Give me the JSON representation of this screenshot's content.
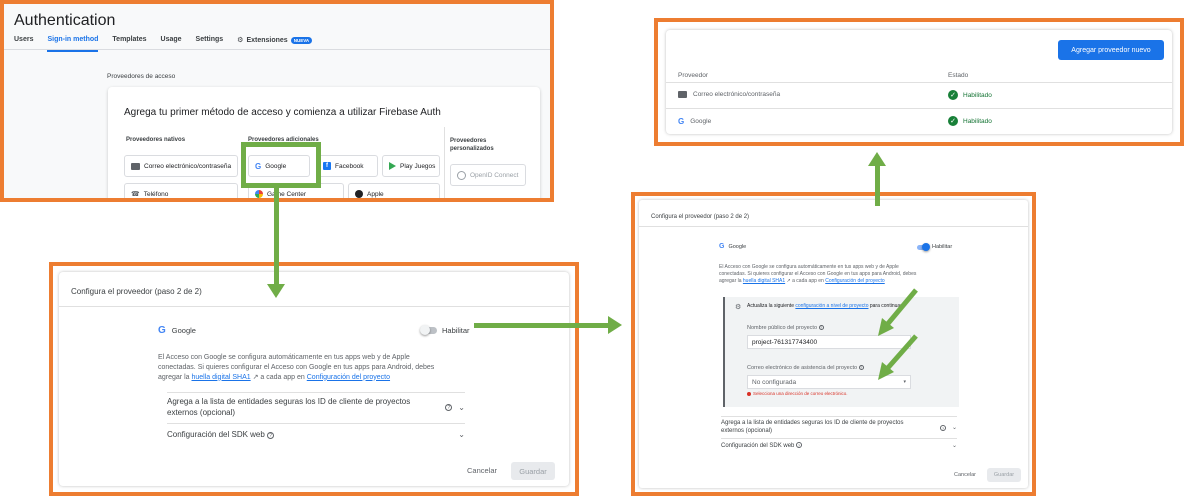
{
  "panel1": {
    "title": "Authentication",
    "tabs": [
      "Users",
      "Sign-in method",
      "Templates",
      "Usage",
      "Settings"
    ],
    "extensions_label": "Extensiones",
    "extensions_badge": "NUEVA",
    "section_label": "Proveedores de acceso",
    "card_title": "Agrega tu primer método de acceso y comienza a utilizar Firebase Auth",
    "col_native": "Proveedores nativos",
    "col_additional": "Proveedores adicionales",
    "col_custom": "Proveedores personalizados",
    "providers": {
      "email": "Correo electrónico/contraseña",
      "phone": "Teléfono",
      "google": "Google",
      "facebook": "Facebook",
      "play": "Play Juegos",
      "game_center": "Game Center",
      "apple": "Apple",
      "openid": "OpenID Connect"
    }
  },
  "panel2": {
    "header": "Configura el proveedor (paso 2 de 2)",
    "provider_name": "Google",
    "toggle_label": "Habilitar",
    "desc_line1": "El Acceso con Google se configura automáticamente en tus apps web y de Apple",
    "desc_line2": "conectadas. Si quieres configurar el Acceso con Google en tus apps para Android, debes",
    "desc_pre": "agregar la",
    "desc_link1": "huella digital SHA1",
    "desc_mid": "a cada app en",
    "desc_link2": "Configuración del proyecto",
    "expand1": "Agrega a la lista de entidades seguras los ID de cliente de proyectos externos (opcional)",
    "expand2": "Configuración del SDK web",
    "cancel": "Cancelar",
    "save": "Guardar"
  },
  "panel3": {
    "header": "Configura el proveedor (paso 2 de 2)",
    "provider_name": "Google",
    "toggle_label": "Habilitar",
    "desc_line1": "El Acceso con Google se configura automáticamente en tus apps web y de Apple",
    "desc_line2": "conectadas. Si quieres configurar el Acceso con Google en tus apps para Android, debes",
    "desc_pre": "agregar la",
    "desc_link1": "huella digital SHA1",
    "desc_mid": "a cada app en",
    "desc_link2": "Configuración del proyecto",
    "info_pre": "Actualiza la siguiente",
    "info_link": "configuración a nivel de proyecto",
    "info_post": "para continuar",
    "public_name_label": "Nombre público del proyecto",
    "public_name_value": "project-761317743400",
    "support_email_label": "Correo electrónico de asistencia del proyecto",
    "support_email_value": "No configurada",
    "error_text": "Selecciona una dirección de correo electrónico.",
    "expand1": "Agrega a la lista de entidades seguras los ID de cliente de proyectos externos (opcional)",
    "expand2": "Configuración del SDK web",
    "cancel": "Cancelar",
    "save": "Guardar"
  },
  "panel4": {
    "add_button": "Agregar proveedor nuevo",
    "col_provider": "Proveedor",
    "col_status": "Estado",
    "rows": [
      {
        "provider": "Correo electrónico/contraseña",
        "status": "Habilitado"
      },
      {
        "provider": "Google",
        "status": "Habilitado"
      }
    ]
  },
  "colors": {
    "frame": "#ed7d31",
    "arrow": "#70ad47",
    "accent": "#1a73e8"
  }
}
